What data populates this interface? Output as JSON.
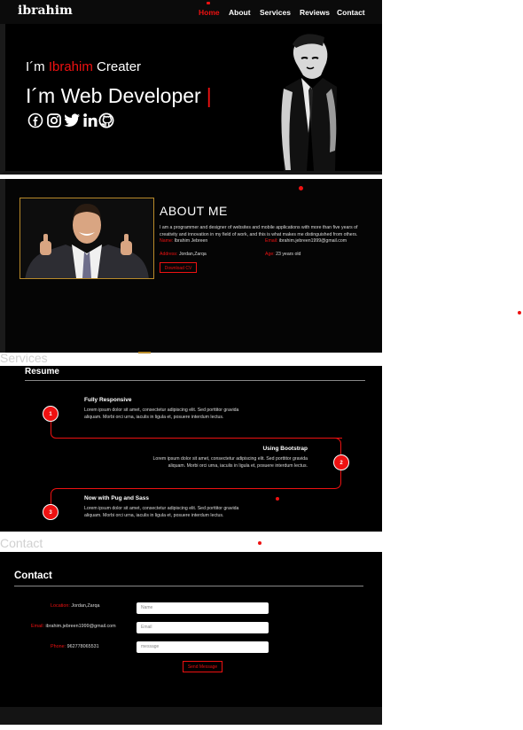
{
  "nav": {
    "logo": "ibrahim",
    "links": [
      "Home",
      "About",
      "Services",
      "Reviews",
      "Contact"
    ],
    "active": "Home"
  },
  "hero": {
    "prefix": "I´m ",
    "name": "Ibrahim",
    "suffix": " Creater",
    "subtitle": "I´m Web Developer",
    "caret": "|",
    "socials": [
      "facebook-icon",
      "instagram-icon",
      "twitter-icon",
      "linkedin-icon",
      "github-icon"
    ]
  },
  "about": {
    "title": "ABOUT ME",
    "text_line1": "I am a programmer and designer of websites and mobile applications with more than five years of",
    "text_line2": "creativity and innovation in my field of work, and this is what makes me distinguished from others.",
    "info": [
      {
        "key": "Name:",
        "value": "Ibrahim Jebreen"
      },
      {
        "key": "Email:",
        "value": "ibrahim.jebreen1999@gmail.com"
      },
      {
        "key": "Address:",
        "value": "Jordan,Zarqa"
      },
      {
        "key": "Age:",
        "value": "23 years old"
      }
    ],
    "button": "Download CV"
  },
  "services_label": "Services",
  "resume": {
    "title": "Resume",
    "steps": [
      {
        "num": "1",
        "title": "Fully Responsive",
        "body": "Lorem ipsum dolor sit amet, consectetur adipiscing elit. Sed porttitor gravida aliquam. Morbi orci urna, iaculis in ligula et, posuere interdum lectus."
      },
      {
        "num": "2",
        "title": "Using Bootstrap",
        "body": "Lorem ipsum dolor sit amet, consectetur adipiscing elit. Sed porttitor gravida aliquam. Morbi orci urna, iaculis in ligula et, posuere interdum lectus."
      },
      {
        "num": "3",
        "title": "Now with Pug and Sass",
        "body": "Lorem ipsum dolor sit amet, consectetur adipiscing elit. Sed porttitor gravida aliquam. Morbi orci urna, iaculis in ligula et, posuere interdum lectus."
      }
    ]
  },
  "contact_label": "Contact",
  "contact": {
    "title": "Contact",
    "info": [
      {
        "key": "Location:",
        "value": "Jordan,Zarqa"
      },
      {
        "key": "Email:",
        "value": "ibrahim.jebreen1999@gmail.com"
      },
      {
        "key": "Phone:",
        "value": "962778065531"
      }
    ],
    "placeholders": {
      "name": "Name",
      "email": "Email",
      "message": "message"
    },
    "button": "Send Message"
  },
  "colors": {
    "accent": "#ee1111",
    "background": "#000000",
    "frame": "#b88a2a"
  }
}
